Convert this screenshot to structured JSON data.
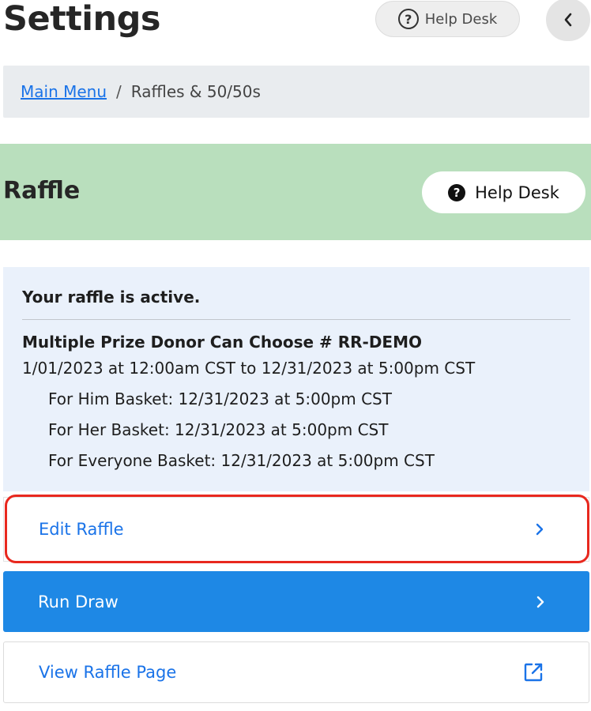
{
  "header": {
    "title": "Settings",
    "help_desk_label": "Help Desk",
    "back_icon": "chevron-left-icon"
  },
  "breadcrumb": {
    "main_menu": "Main Menu",
    "separator": "/",
    "current": "Raffles & 50/50s"
  },
  "banner": {
    "title": "Raffle",
    "help_desk_label": "Help Desk",
    "background": "#b9dfbd"
  },
  "status": {
    "heading": "Your raffle is active.",
    "raffle_name": "Multiple Prize Donor Can Choose # RR-DEMO",
    "date_range": "1/01/2023 at 12:00am CST to 12/31/2023 at 5:00pm CST",
    "prizes": [
      "For Him Basket: 12/31/2023 at 5:00pm CST",
      "For Her Basket: 12/31/2023 at 5:00pm CST",
      "For Everyone Basket: 12/31/2023 at 5:00pm CST"
    ]
  },
  "actions": {
    "edit_raffle": "Edit Raffle",
    "run_draw": "Run Draw",
    "view_raffle_page": "View Raffle Page"
  },
  "colors": {
    "accent": "#1a73e8",
    "primary_button": "#1e88e5",
    "highlight": "#e8281e",
    "status_card_bg": "#eaf1fb"
  }
}
